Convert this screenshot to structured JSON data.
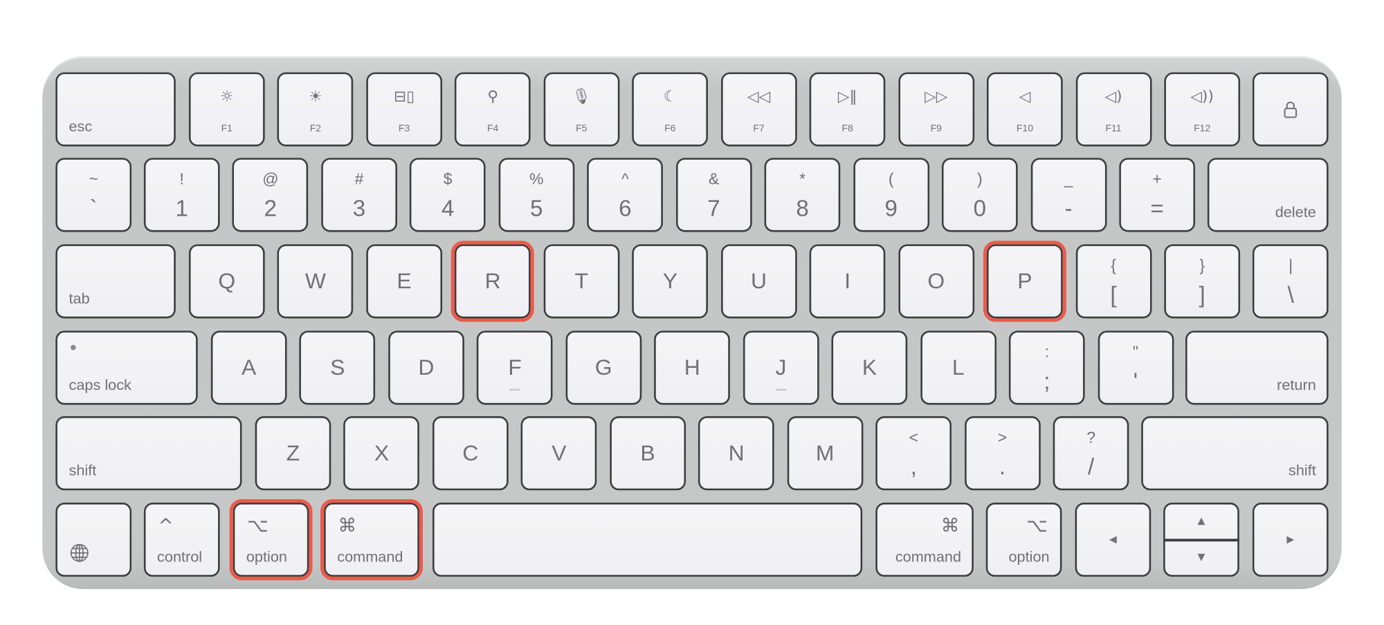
{
  "keyboard": {
    "highlight_color": "#ec5a4b",
    "highlighted_keys": [
      "r",
      "p",
      "option-left",
      "command-left"
    ],
    "rows": [
      [
        {
          "id": "esc",
          "type": "mod",
          "label": "esc"
        },
        {
          "id": "f1",
          "type": "fn",
          "icon": "brightness-down-icon",
          "glyph": "☼",
          "label": "F1"
        },
        {
          "id": "f2",
          "type": "fn",
          "icon": "brightness-up-icon",
          "glyph": "☀",
          "label": "F2"
        },
        {
          "id": "f3",
          "type": "fn",
          "icon": "mission-control-icon",
          "glyph": "⊟▯",
          "label": "F3"
        },
        {
          "id": "f4",
          "type": "fn",
          "icon": "search-icon",
          "glyph": "⚲",
          "label": "F4"
        },
        {
          "id": "f5",
          "type": "fn",
          "icon": "microphone-icon",
          "glyph": "🎙",
          "label": "F5"
        },
        {
          "id": "f6",
          "type": "fn",
          "icon": "moon-icon",
          "glyph": "☾",
          "label": "F6"
        },
        {
          "id": "f7",
          "type": "fn",
          "icon": "rewind-icon",
          "glyph": "◁◁",
          "label": "F7"
        },
        {
          "id": "f8",
          "type": "fn",
          "icon": "play-pause-icon",
          "glyph": "▷‖",
          "label": "F8"
        },
        {
          "id": "f9",
          "type": "fn",
          "icon": "fast-forward-icon",
          "glyph": "▷▷",
          "label": "F9"
        },
        {
          "id": "f10",
          "type": "fn",
          "icon": "mute-icon",
          "glyph": "◁",
          "label": "F10"
        },
        {
          "id": "f11",
          "type": "fn",
          "icon": "volume-down-icon",
          "glyph": "◁)",
          "label": "F11"
        },
        {
          "id": "f12",
          "type": "fn",
          "icon": "volume-up-icon",
          "glyph": "◁))",
          "label": "F12"
        },
        {
          "id": "lock",
          "type": "lock",
          "icon": "lock-icon"
        }
      ],
      [
        {
          "id": "grave",
          "type": "dual",
          "top": "~",
          "bottom": "`"
        },
        {
          "id": "1",
          "type": "dual",
          "top": "!",
          "bottom": "1"
        },
        {
          "id": "2",
          "type": "dual",
          "top": "@",
          "bottom": "2"
        },
        {
          "id": "3",
          "type": "dual",
          "top": "#",
          "bottom": "3"
        },
        {
          "id": "4",
          "type": "dual",
          "top": "$",
          "bottom": "4"
        },
        {
          "id": "5",
          "type": "dual",
          "top": "%",
          "bottom": "5"
        },
        {
          "id": "6",
          "type": "dual",
          "top": "^",
          "bottom": "6"
        },
        {
          "id": "7",
          "type": "dual",
          "top": "&",
          "bottom": "7"
        },
        {
          "id": "8",
          "type": "dual",
          "top": "*",
          "bottom": "8"
        },
        {
          "id": "9",
          "type": "dual",
          "top": "(",
          "bottom": "9"
        },
        {
          "id": "0",
          "type": "dual",
          "top": ")",
          "bottom": "0"
        },
        {
          "id": "minus",
          "type": "dual",
          "top": "_",
          "bottom": "-"
        },
        {
          "id": "equals",
          "type": "dual",
          "top": "+",
          "bottom": "="
        },
        {
          "id": "delete",
          "type": "mod",
          "label": "delete",
          "align": "right"
        }
      ],
      [
        {
          "id": "tab",
          "type": "mod",
          "label": "tab"
        },
        {
          "id": "q",
          "type": "letter",
          "label": "Q"
        },
        {
          "id": "w",
          "type": "letter",
          "label": "W"
        },
        {
          "id": "e",
          "type": "letter",
          "label": "E"
        },
        {
          "id": "r",
          "type": "letter",
          "label": "R"
        },
        {
          "id": "t",
          "type": "letter",
          "label": "T"
        },
        {
          "id": "y",
          "type": "letter",
          "label": "Y"
        },
        {
          "id": "u",
          "type": "letter",
          "label": "U"
        },
        {
          "id": "i",
          "type": "letter",
          "label": "I"
        },
        {
          "id": "o",
          "type": "letter",
          "label": "O"
        },
        {
          "id": "p",
          "type": "letter",
          "label": "P"
        },
        {
          "id": "bracket-left",
          "type": "dual",
          "top": "{",
          "bottom": "["
        },
        {
          "id": "bracket-right",
          "type": "dual",
          "top": "}",
          "bottom": "]"
        },
        {
          "id": "backslash",
          "type": "dual",
          "top": "|",
          "bottom": "\\"
        }
      ],
      [
        {
          "id": "caps-lock",
          "type": "mod",
          "label": "caps lock",
          "dot": true
        },
        {
          "id": "a",
          "type": "letter",
          "label": "A"
        },
        {
          "id": "s",
          "type": "letter",
          "label": "S"
        },
        {
          "id": "d",
          "type": "letter",
          "label": "D"
        },
        {
          "id": "f",
          "type": "letter",
          "label": "F",
          "bump": true
        },
        {
          "id": "g",
          "type": "letter",
          "label": "G"
        },
        {
          "id": "h",
          "type": "letter",
          "label": "H"
        },
        {
          "id": "j",
          "type": "letter",
          "label": "J",
          "bump": true
        },
        {
          "id": "k",
          "type": "letter",
          "label": "K"
        },
        {
          "id": "l",
          "type": "letter",
          "label": "L"
        },
        {
          "id": "semicolon",
          "type": "dual",
          "top": ":",
          "bottom": ";"
        },
        {
          "id": "quote",
          "type": "dual",
          "top": "\"",
          "bottom": "'"
        },
        {
          "id": "return",
          "type": "mod",
          "label": "return",
          "align": "right"
        }
      ],
      [
        {
          "id": "shift-left",
          "type": "mod",
          "label": "shift"
        },
        {
          "id": "z",
          "type": "letter",
          "label": "Z"
        },
        {
          "id": "x",
          "type": "letter",
          "label": "X"
        },
        {
          "id": "c",
          "type": "letter",
          "label": "C"
        },
        {
          "id": "v",
          "type": "letter",
          "label": "V"
        },
        {
          "id": "b",
          "type": "letter",
          "label": "B"
        },
        {
          "id": "n",
          "type": "letter",
          "label": "N"
        },
        {
          "id": "m",
          "type": "letter",
          "label": "M"
        },
        {
          "id": "comma",
          "type": "dual",
          "top": "<",
          "bottom": ","
        },
        {
          "id": "period",
          "type": "dual",
          "top": ">",
          "bottom": "."
        },
        {
          "id": "slash",
          "type": "dual",
          "top": "?",
          "bottom": "/"
        },
        {
          "id": "shift-right",
          "type": "mod",
          "label": "shift",
          "align": "right"
        }
      ],
      [
        {
          "id": "globe",
          "type": "globe",
          "icon": "globe-icon"
        },
        {
          "id": "control",
          "type": "mod",
          "label": "control",
          "symbol": "^"
        },
        {
          "id": "option-left",
          "type": "mod",
          "label": "option",
          "symbol": "⌥"
        },
        {
          "id": "command-left",
          "type": "mod",
          "label": "command",
          "symbol": "⌘"
        },
        {
          "id": "space",
          "type": "blank"
        },
        {
          "id": "command-right",
          "type": "mod",
          "label": "command",
          "symbol": "⌘",
          "align": "right"
        },
        {
          "id": "option-right",
          "type": "mod",
          "label": "option",
          "symbol": "⌥",
          "align": "right"
        },
        {
          "id": "arrow-left",
          "type": "arrow",
          "glyph": "◀",
          "icon": "arrow-left-icon"
        },
        {
          "id": "arrow-up-down",
          "type": "updown",
          "up": "▲",
          "down": "▼"
        },
        {
          "id": "arrow-right",
          "type": "arrow",
          "glyph": "▶",
          "icon": "arrow-right-icon"
        }
      ]
    ]
  }
}
